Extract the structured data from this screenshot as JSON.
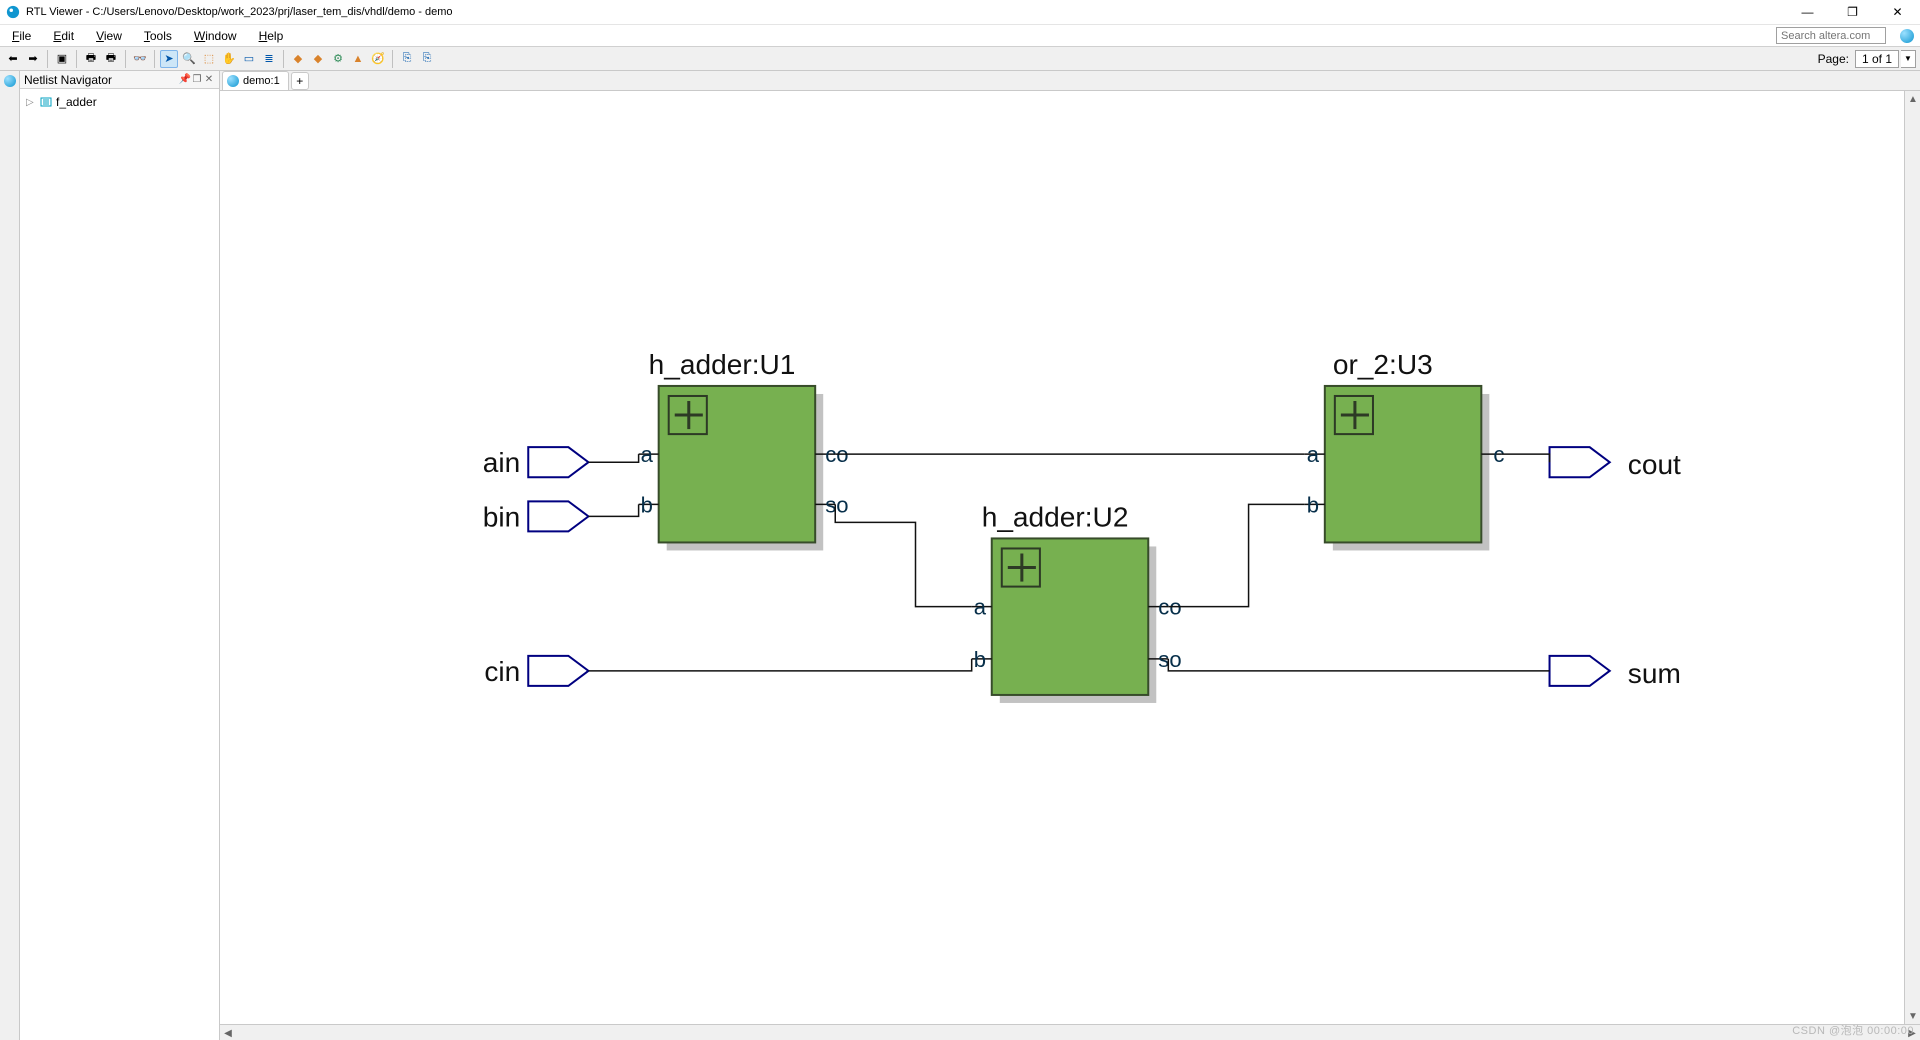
{
  "window": {
    "title": "RTL Viewer - C:/Users/Lenovo/Desktop/work_2023/prj/laser_tem_dis/vhdl/demo - demo"
  },
  "menu": {
    "file": "File",
    "edit": "Edit",
    "view": "View",
    "tools": "Tools",
    "window": "Window",
    "help": "Help",
    "search_placeholder": "Search altera.com"
  },
  "toolbar": {
    "page_label": "Page:",
    "page_value": "1 of 1"
  },
  "panel": {
    "title": "Netlist Navigator",
    "root": "f_adder"
  },
  "tab": {
    "name": "demo:1"
  },
  "schematic": {
    "inputs": {
      "ain": "ain",
      "bin": "bin",
      "cin": "cin"
    },
    "outputs": {
      "cout": "cout",
      "sum": "sum"
    },
    "blocks": {
      "u1": {
        "title": "h_adder:U1",
        "ports": {
          "a": "a",
          "b": "b",
          "co": "co",
          "so": "so"
        }
      },
      "u2": {
        "title": "h_adder:U2",
        "ports": {
          "a": "a",
          "b": "b",
          "co": "co",
          "so": "so"
        }
      },
      "u3": {
        "title": "or_2:U3",
        "ports": {
          "a": "a",
          "b": "b",
          "c": "c"
        }
      }
    }
  },
  "watermark": "CSDN @泡泡 00:00:00"
}
